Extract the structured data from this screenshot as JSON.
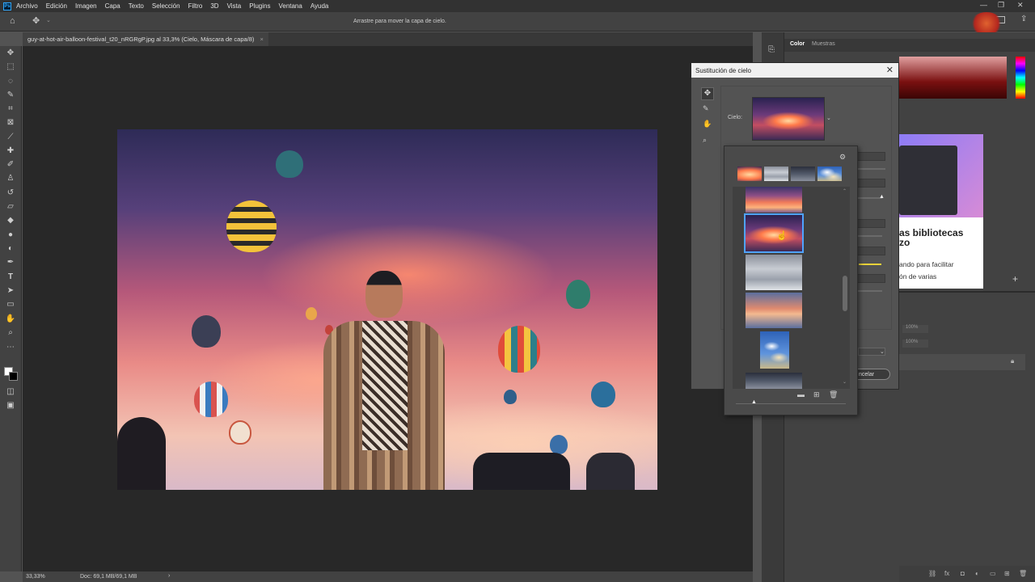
{
  "app": {
    "logo_text": "Ps",
    "menu": [
      "Archivo",
      "Edición",
      "Imagen",
      "Capa",
      "Texto",
      "Selección",
      "Filtro",
      "3D",
      "Vista",
      "Plugins",
      "Ventana",
      "Ayuda"
    ],
    "window_controls": [
      "—",
      "❐",
      "✕"
    ]
  },
  "options_bar": {
    "hint": "Arrastre para mover la capa de cielo."
  },
  "document": {
    "tab_title": "guy-at-hot-air-balloon-festival_t20_nRGRgP.jpg al 33,3% (Cielo, Máscara de capa/8)",
    "tab_close": "×"
  },
  "status_bar": {
    "zoom": "33,33%",
    "doc_info": "Doc: 69,1 MB/69,1 MB",
    "arrow": "›"
  },
  "panels": {
    "tabs": [
      "Color",
      "Muestras"
    ],
    "learn_title": "as bibliotecas\nzo",
    "learn_text_1": "ando para facilitar",
    "learn_text_2": "ón de varias",
    "zoom_1": "100%",
    "zoom_2": "100%",
    "add_icon": "+"
  },
  "dialog": {
    "title": "Sustitución de cielo",
    "close": "✕",
    "sky_label": "Cielo:",
    "cancel_button": "ncelar"
  },
  "sky_picker": {
    "presets_groups": [
      "sunset",
      "grey",
      "grey-blue",
      "blue"
    ],
    "thumbnails": [
      "sunset",
      "fire",
      "grey",
      "dusk",
      "blue",
      "storm"
    ],
    "selected_index": 1
  }
}
